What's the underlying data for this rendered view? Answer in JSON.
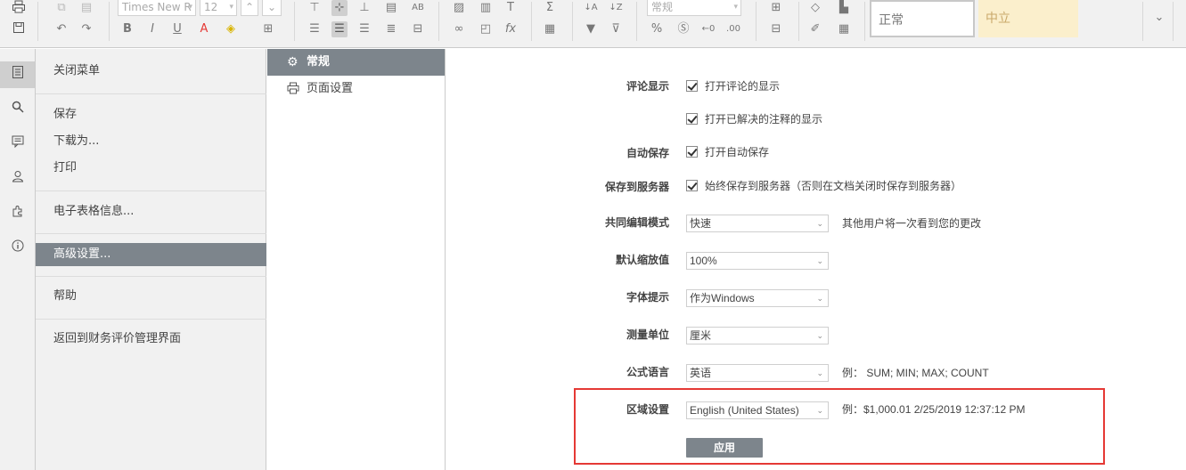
{
  "toolbar": {
    "font_name": "Times New R",
    "font_size": "12",
    "number_format": "常规",
    "style_normal": "正常",
    "style_neutral": "中立",
    "colors": {
      "toolbar_bg": "#f1f1f1",
      "active_bg": "#7d858c",
      "neutral_bg": "#fbefcc",
      "neutral_text": "#c9a86a",
      "highlight": "#e53935"
    }
  },
  "rail": {
    "items": [
      {
        "icon": "document-icon"
      },
      {
        "icon": "search-icon"
      },
      {
        "icon": "comment-icon"
      },
      {
        "icon": "user-icon"
      },
      {
        "icon": "plugin-icon"
      },
      {
        "icon": "info-icon"
      }
    ]
  },
  "menu": {
    "close": "关闭菜单",
    "save": "保存",
    "download": "下载为...",
    "print": "打印",
    "info": "电子表格信息...",
    "advanced": "高级设置...",
    "help": "帮助",
    "back": "返回到财务评价管理界面"
  },
  "subtabs": {
    "general": "常规",
    "page_setup": "页面设置"
  },
  "settings": {
    "comments_label": "评论显示",
    "comments_opt1": "打开评论的显示",
    "comments_opt2": "打开已解决的注释的显示",
    "autosave_label": "自动保存",
    "autosave_opt": "打开自动保存",
    "server_label": "保存到服务器",
    "server_opt": "始终保存到服务器（否则在文档关闭时保存到服务器）",
    "coedit_label": "共同编辑模式",
    "coedit_value": "快速",
    "coedit_hint": "其他用户将一次看到您的更改",
    "zoom_label": "默认缩放值",
    "zoom_value": "100%",
    "hinting_label": "字体提示",
    "hinting_value": "作为Windows",
    "unit_label": "测量单位",
    "unit_value": "厘米",
    "formula_label": "公式语言",
    "formula_value": "英语",
    "formula_hint": "例： SUM; MIN; MAX; COUNT",
    "region_label": "区域设置",
    "region_value": "English (United States)",
    "region_hint": "例：$1,000.01 2/25/2019 12:37:12 PM",
    "apply": "应用"
  }
}
